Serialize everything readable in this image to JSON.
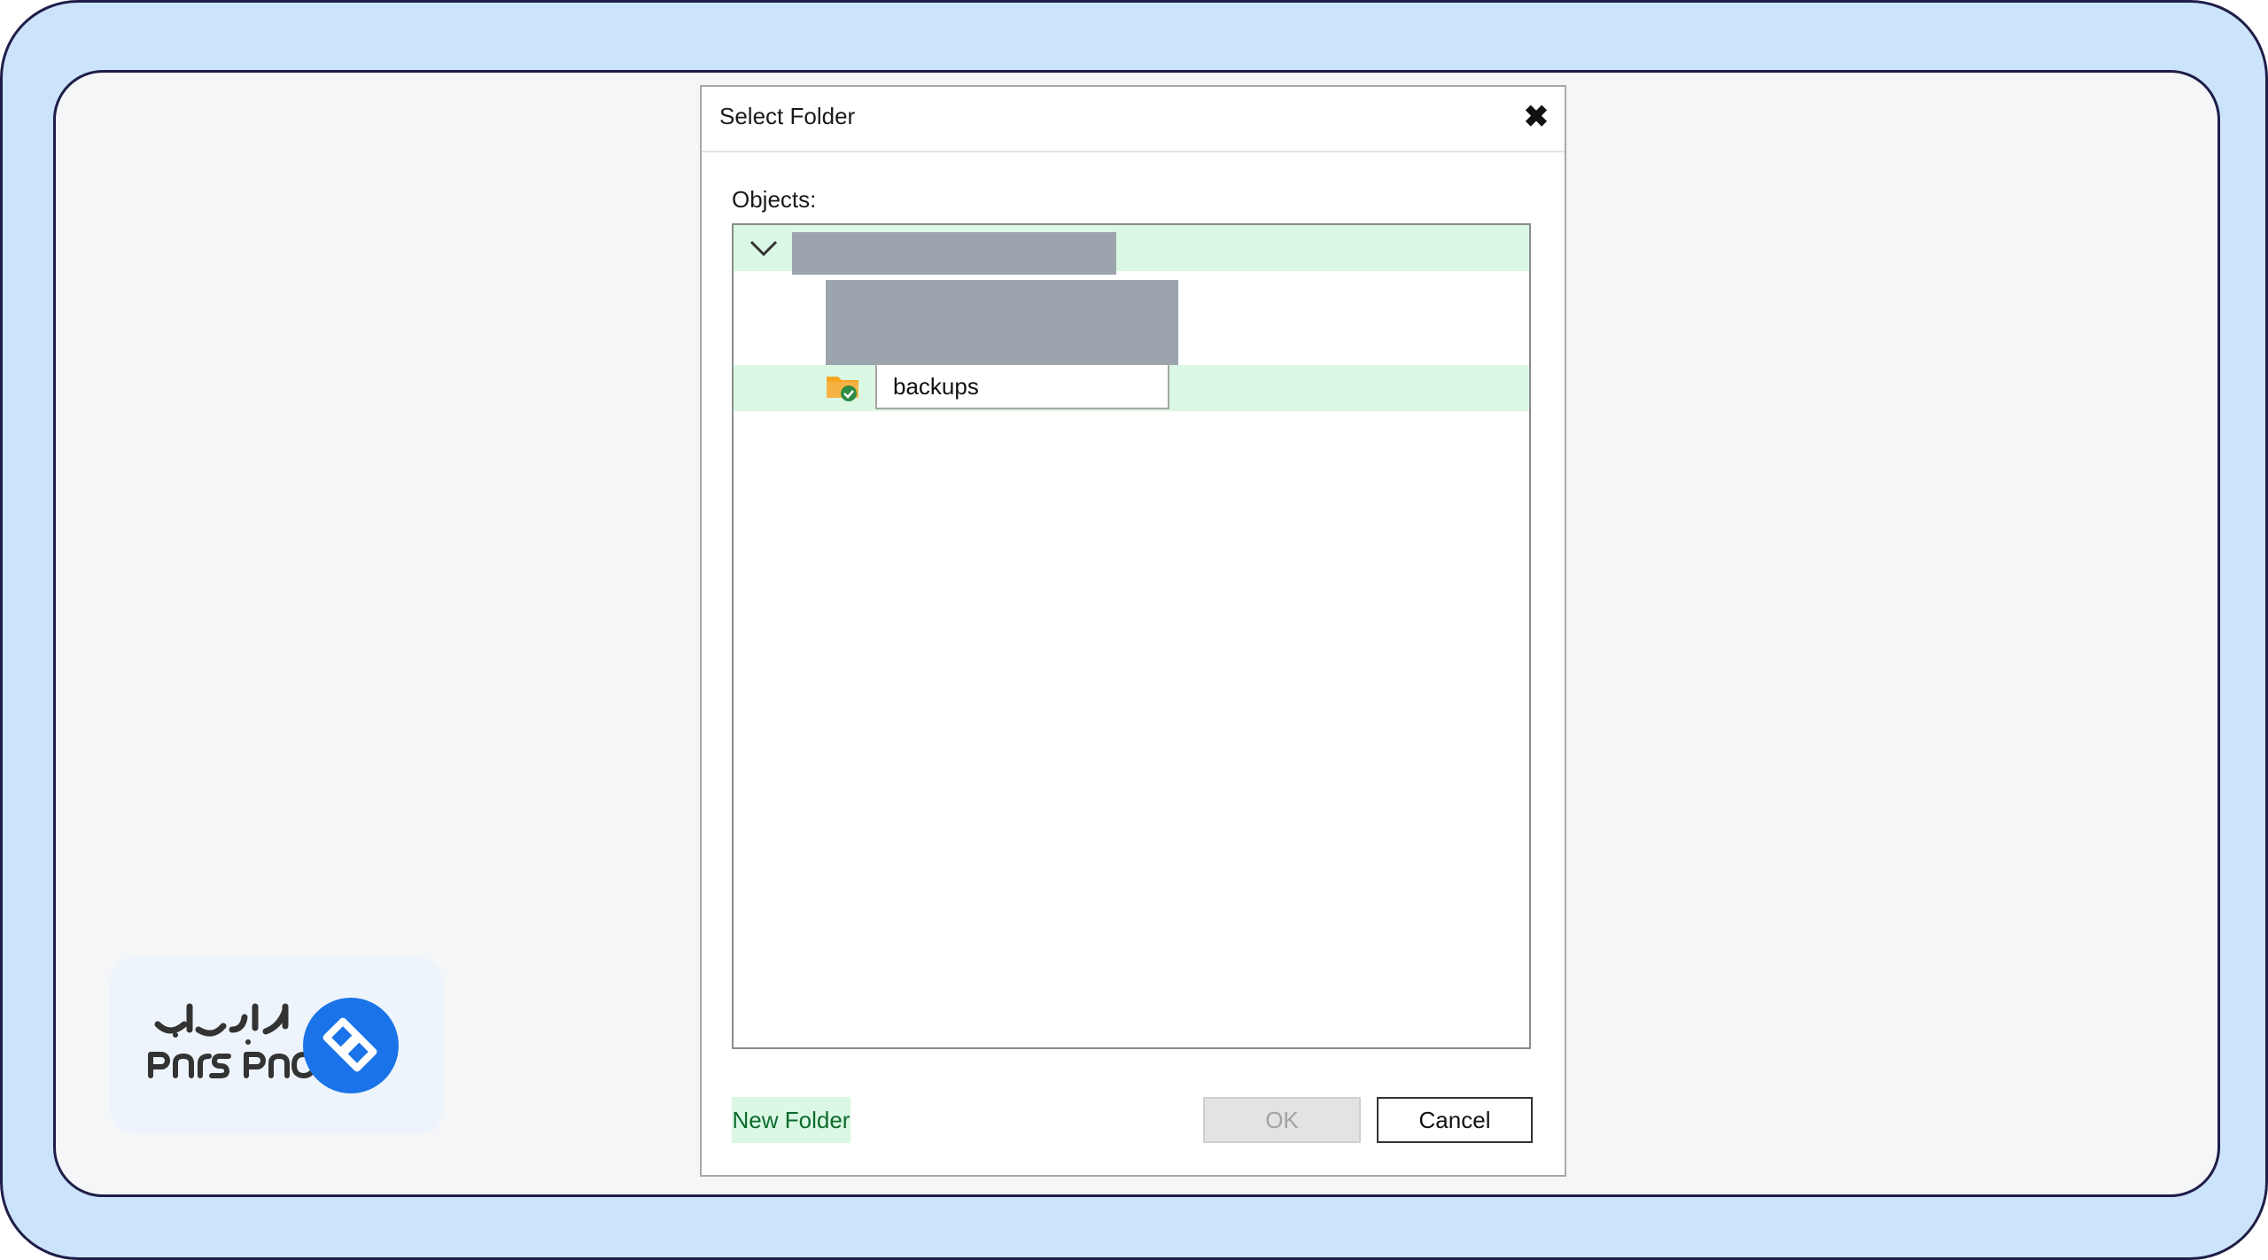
{
  "dialog": {
    "title": "Select Folder",
    "close_icon": "close-icon",
    "objects_label": "Objects:",
    "tree": {
      "root": {
        "expanded": true,
        "label_redacted": true
      },
      "child": {
        "label_redacted": true
      },
      "editing_item": {
        "icon": "folder-icon",
        "value": "backups"
      }
    },
    "buttons": {
      "new_folder": "New Folder",
      "ok": "OK",
      "cancel": "Cancel"
    }
  },
  "logo": {
    "text_fa": "پارس‌پک",
    "text_en": "Pars Pack",
    "brand_color": "#1a73e8"
  },
  "colors": {
    "outer_frame": "#cce4fb",
    "frame_border": "#1f1d4a",
    "selection": "#daf8e4",
    "redaction": "#9ca5ae"
  }
}
